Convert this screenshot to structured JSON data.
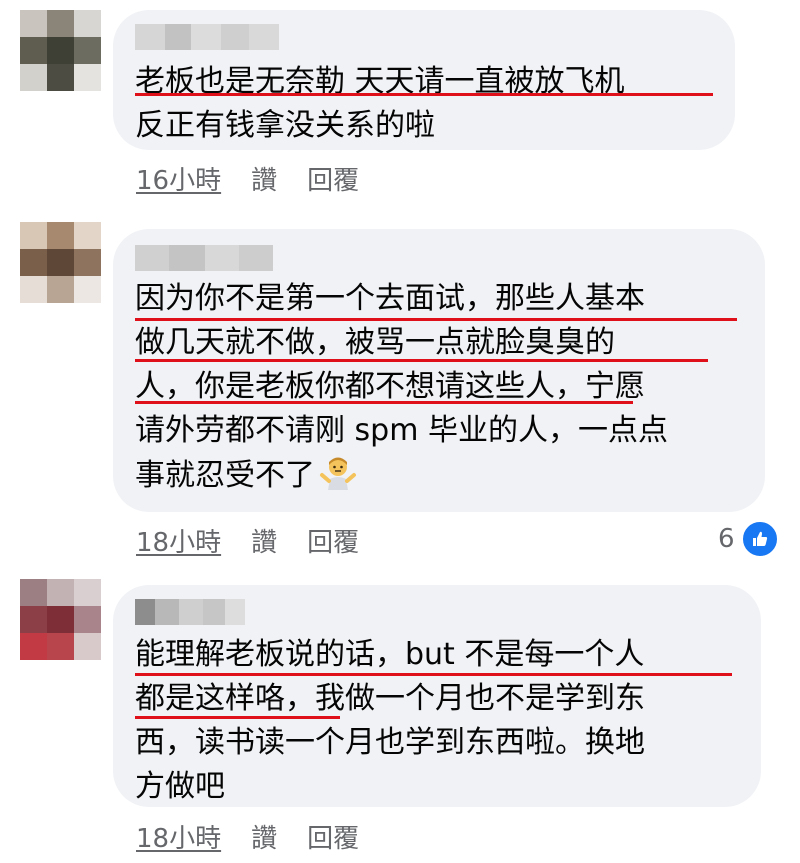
{
  "comments": [
    {
      "lines": [
        "老板也是无奈勒 天天请一直被放飞机",
        "反正有钱拿没关系的啦"
      ],
      "time": "16小時",
      "like_label": "讚",
      "reply_label": "回覆"
    },
    {
      "lines": [
        "因为你不是第一个去面试，那些人基本",
        "做几天就不做，被骂一点就脸臭臭的",
        "人，你是老板你都不想请这些人，宁愿",
        "请外劳都不请刚 spm 毕业的人，一点点",
        "事就忍受不了"
      ],
      "time": "18小時",
      "like_label": "讚",
      "reply_label": "回覆",
      "reaction_count": "6"
    },
    {
      "lines": [
        "能理解老板说的话，but 不是每一个人",
        "都是这样咯，我做一个月也不是学到东",
        "西，读书读一个月也学到东西啦。换地",
        "方做吧"
      ],
      "time": "18小時",
      "like_label": "讚",
      "reply_label": "回覆"
    }
  ],
  "icons": {
    "emoji": "person-shrugging-icon",
    "reaction": "like-thumb-icon"
  },
  "colors": {
    "bubble": "#f0f2f5",
    "underline": "#e0101a",
    "meta_text": "#65676b",
    "like_blue": "#1877f2"
  }
}
